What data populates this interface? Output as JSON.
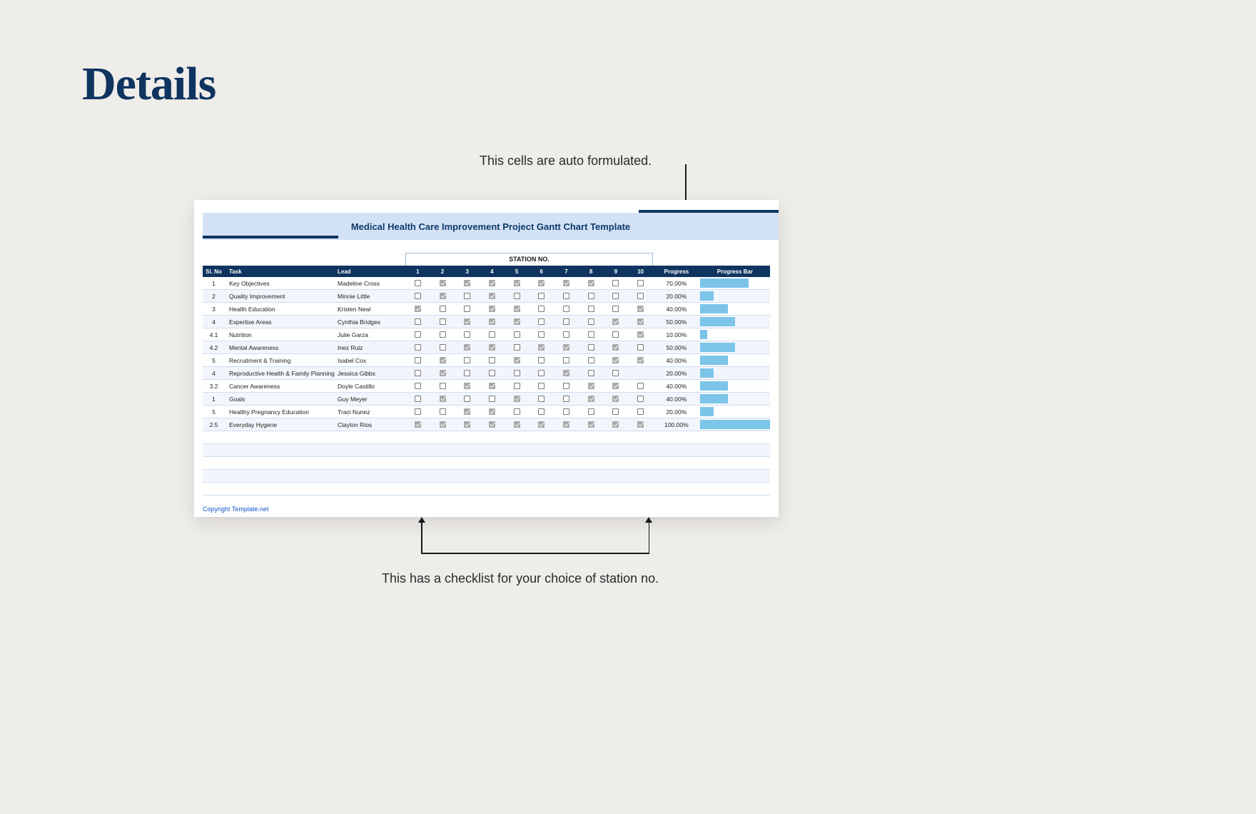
{
  "page_title": "Details",
  "annotations": {
    "top": "This cells are auto formulated.",
    "bottom": "This has a checklist for your choice of station no."
  },
  "sheet": {
    "title": "Medical Health Care Improvement Project Gantt Chart Template",
    "station_header": "STATION NO.",
    "columns": {
      "sl": "Sl. No",
      "task": "Task",
      "lead": "Lead",
      "stations": [
        "1",
        "2",
        "3",
        "4",
        "5",
        "6",
        "7",
        "8",
        "9",
        "10"
      ],
      "progress": "Progress",
      "progress_bar": "Progress Bar"
    },
    "rows": [
      {
        "sl": "1",
        "task": "Key Objectives",
        "lead": "Madeline Cross",
        "checks": [
          0,
          1,
          1,
          1,
          1,
          1,
          1,
          1,
          0,
          0
        ],
        "progress": "70.00%",
        "bar_pct": 70
      },
      {
        "sl": "2",
        "task": "Quality Improvement",
        "lead": "Minnie Little",
        "checks": [
          0,
          1,
          0,
          1,
          0,
          0,
          0,
          0,
          0,
          0
        ],
        "progress": "20.00%",
        "bar_pct": 20
      },
      {
        "sl": "3",
        "task": "Health Education",
        "lead": "Kristen Neal",
        "checks": [
          1,
          0,
          0,
          1,
          1,
          0,
          0,
          0,
          0,
          1
        ],
        "progress": "40.00%",
        "bar_pct": 40
      },
      {
        "sl": "4",
        "task": "Expertise Areas",
        "lead": "Cynthia Bridges",
        "checks": [
          0,
          0,
          1,
          1,
          1,
          0,
          0,
          0,
          1,
          1
        ],
        "progress": "50.00%",
        "bar_pct": 50
      },
      {
        "sl": "4.1",
        "task": "Nutrition",
        "lead": "Julie Garza",
        "checks": [
          0,
          0,
          0,
          0,
          0,
          0,
          0,
          0,
          0,
          1
        ],
        "progress": "10.00%",
        "bar_pct": 10
      },
      {
        "sl": "4.2",
        "task": "Mental Awareness",
        "lead": "Inez Ruiz",
        "checks": [
          0,
          0,
          1,
          1,
          0,
          1,
          1,
          0,
          1,
          0
        ],
        "progress": "50.00%",
        "bar_pct": 50
      },
      {
        "sl": "5",
        "task": "Recruitment & Training",
        "lead": "Isabel Cox",
        "checks": [
          0,
          1,
          0,
          0,
          1,
          0,
          0,
          0,
          1,
          1
        ],
        "progress": "40.00%",
        "bar_pct": 40
      },
      {
        "sl": "4",
        "task": "Reproductive Health & Family Planning",
        "lead": "Jessica Gibbs",
        "checks": [
          0,
          1,
          0,
          0,
          0,
          0,
          1,
          0,
          0,
          null
        ],
        "progress": "20.00%",
        "bar_pct": 20
      },
      {
        "sl": "3.2",
        "task": "Cancer Awareness",
        "lead": "Doyle Castillo",
        "checks": [
          0,
          0,
          1,
          1,
          0,
          0,
          0,
          1,
          1,
          0
        ],
        "progress": "40.00%",
        "bar_pct": 40
      },
      {
        "sl": "1",
        "task": "Goals",
        "lead": "Guy Meyer",
        "checks": [
          0,
          1,
          0,
          0,
          1,
          0,
          0,
          1,
          1,
          0
        ],
        "progress": "40.00%",
        "bar_pct": 40
      },
      {
        "sl": "5",
        "task": "Healthy Pregnancy Education",
        "lead": "Traci Nunez",
        "checks": [
          0,
          0,
          1,
          1,
          0,
          0,
          0,
          0,
          0,
          0
        ],
        "progress": "20.00%",
        "bar_pct": 20
      },
      {
        "sl": "2.5",
        "task": "Everyday Hygene",
        "lead": "Clayton Rios",
        "checks": [
          1,
          1,
          1,
          1,
          1,
          1,
          1,
          1,
          1,
          1
        ],
        "progress": "100.00%",
        "bar_pct": 100
      }
    ],
    "empty_rows": 5,
    "footer": "Copyright Template.net"
  }
}
